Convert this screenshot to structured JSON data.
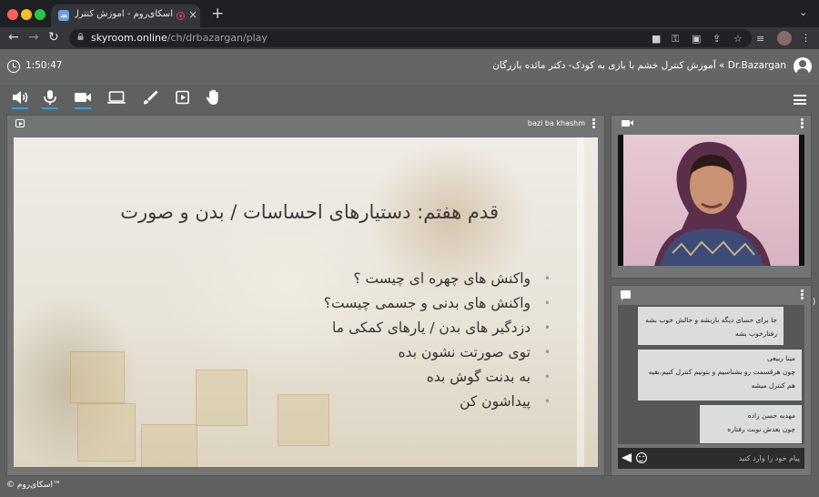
{
  "browser": {
    "tab_title": "اسکای‌روم - آموزش کنترل خشم با بازی به کودک- دکتر مائده بازرگان",
    "tab_favicon": "skyroom",
    "new_tab": "+",
    "tab_menu": "⌄",
    "url_domain": "skyroom.online",
    "url_path": "/ch/drbazargan/play",
    "colors": {
      "tab_strip": "#1f2023",
      "toolbar": "#35363a",
      "close": "#ff5f57",
      "minimize": "#febc2e",
      "zoom": "#28c840"
    }
  },
  "header": {
    "timer": "1:50:47",
    "room_title": "Dr.Bazargan » آموزش کنترل خشم با بازی به کودک- دکتر مائده بازرگان"
  },
  "controls": {
    "active_color": "#2fa2e0",
    "items": [
      "speaker-icon",
      "microphone-icon",
      "camera-icon",
      "screen-share-icon",
      "brush-icon",
      "media-play-icon",
      "raise-hand-icon"
    ]
  },
  "board": {
    "name": "bazi ba khashm",
    "slide_title": "قدم هفتم: دستیارهای احساسات / بدن و صورت",
    "bullets": [
      "واکنش های چهره ای چیست ؟",
      "واکنش های بدنی و جسمی چیست؟",
      "دزدگیر های بدن / یارهای کمکی ما",
      "توی صورتت نشون بده",
      "به بدنت گوش بده",
      "پیداشون کن"
    ]
  },
  "chat": {
    "messages": [
      {
        "name": "",
        "text": "جا برای حسای دیگه بازبشه و حالش خوب بشه رفتارخوب بشه"
      },
      {
        "name": "مینا ربیعی",
        "text": "چون هرقسمت رو بشناسیم و بتونیم کنترل کنیم،بقیه هم کنترل میشه"
      },
      {
        "name": "مهدیه حسن زاده",
        "text": "چون بعدش نوبت رفتاره"
      }
    ],
    "input_placeholder": "پیام خود را وارد کنید"
  },
  "footer": {
    "brand": "© اسکای‌روم™"
  }
}
